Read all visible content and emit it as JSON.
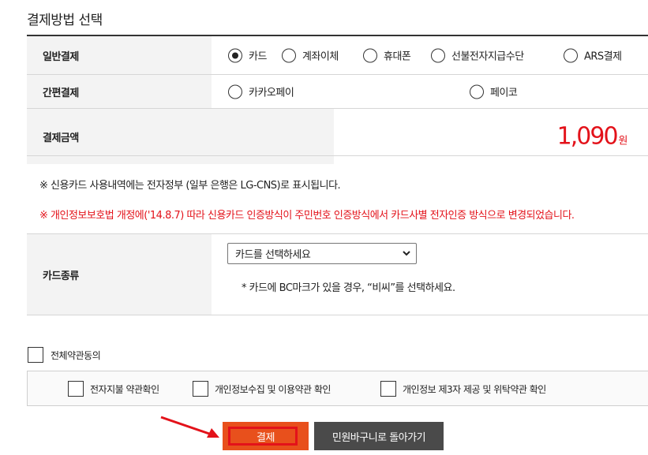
{
  "section_title": "결제방법 선택",
  "general": {
    "label": "일반결제",
    "options": [
      {
        "label": "카드",
        "checked": true
      },
      {
        "label": "계좌이체",
        "checked": false
      },
      {
        "label": "휴대폰",
        "checked": false
      },
      {
        "label": "선불전자지급수단",
        "checked": false
      },
      {
        "label": "ARS결제",
        "checked": false
      }
    ]
  },
  "easy": {
    "label": "간편결제",
    "options": [
      {
        "label": "카카오페이",
        "checked": false
      },
      {
        "label": "페이코",
        "checked": false
      }
    ]
  },
  "amount": {
    "label": "결제금액",
    "value": "1,090",
    "unit": "원",
    "color": "#e3121a"
  },
  "notices": {
    "line1": "※ 신용카드 사용내역에는 전자정부 (일부 은행은 LG-CNS)로 표시됩니다.",
    "line2": "※ 개인정보보호법 개정에('14.8.7) 따라 신용카드 인증방식이 주민번호 인증방식에서 카드사별 전자인증 방식으로 변경되었습니다."
  },
  "card": {
    "label": "카드종류",
    "select_value": "카드를 선택하세요",
    "note": "* 카드에 BC마크가 있을 경우, “비씨”를 선택하세요."
  },
  "agreements": {
    "all_label": "전체약관동의",
    "items": [
      "전자지불 약관확인",
      "개인정보수집 및 이용약관 확인",
      "개인정보 제3자 제공 및 위탁약관 확인"
    ]
  },
  "buttons": {
    "pay": "결제",
    "pay_color": "#e8501c",
    "back": "민원바구니로 돌아가기",
    "back_color": "#4a4a4a"
  }
}
